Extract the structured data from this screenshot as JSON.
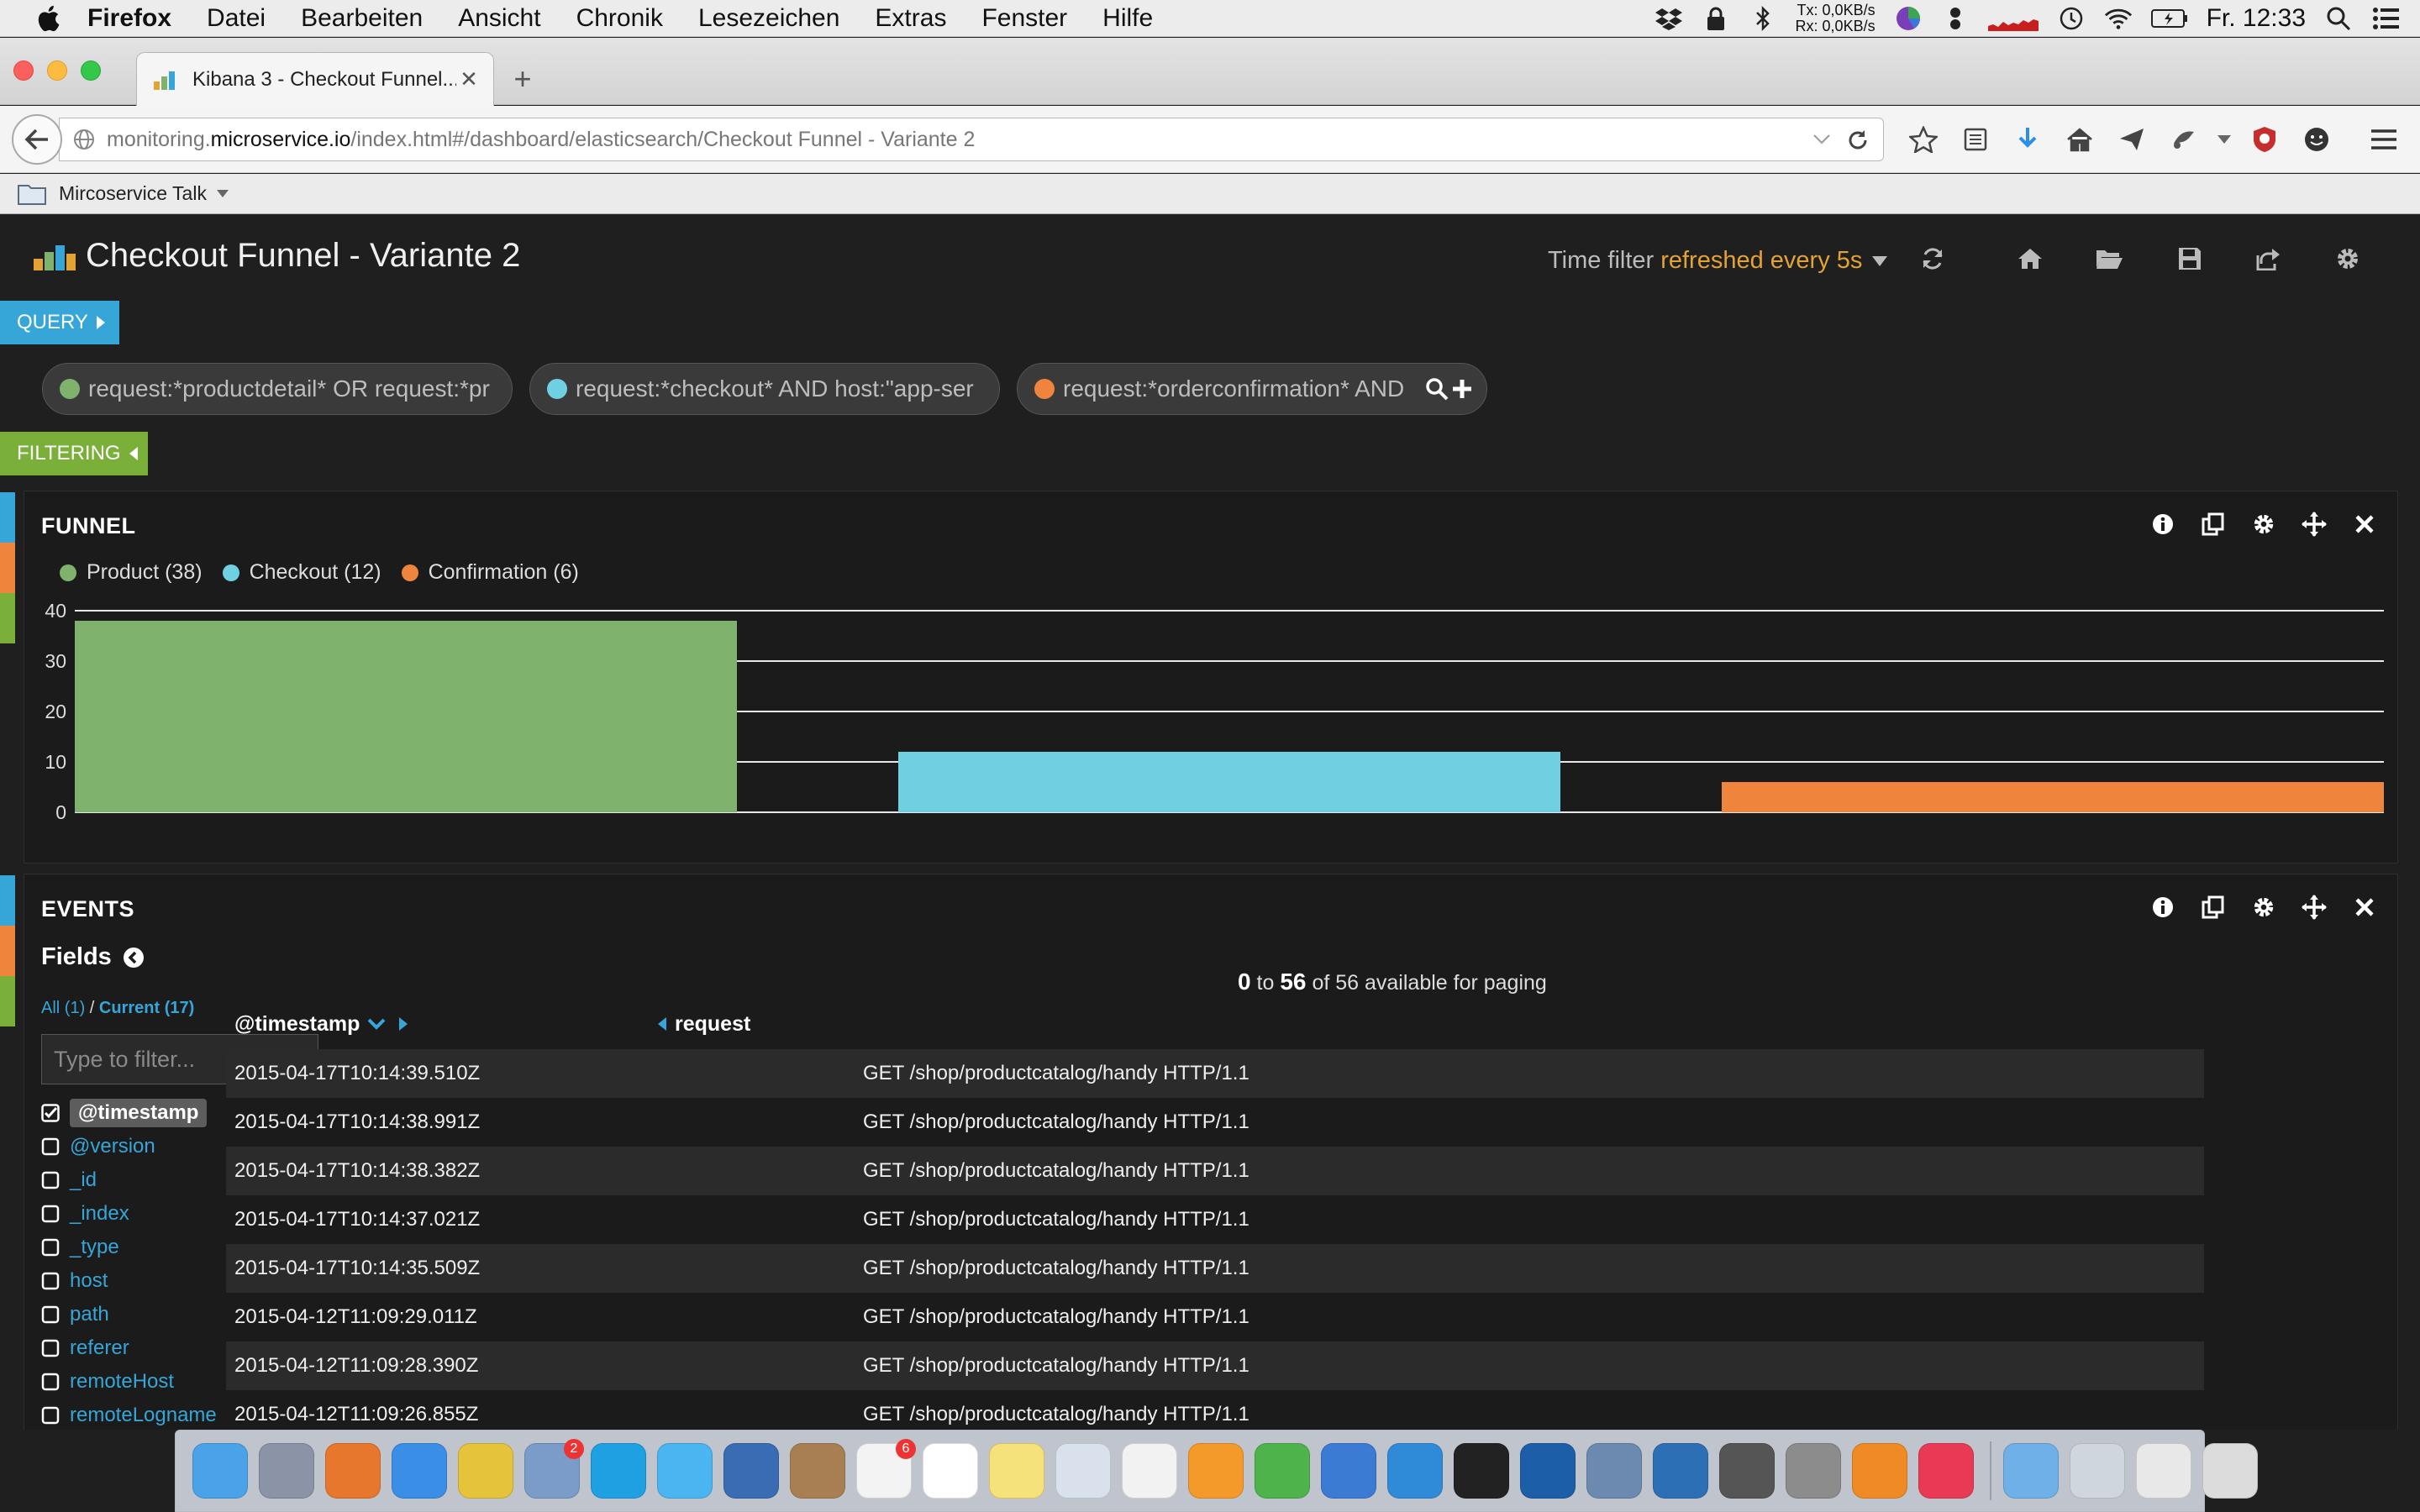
{
  "menubar": {
    "app_name": "Firefox",
    "items": [
      "Datei",
      "Bearbeiten",
      "Ansicht",
      "Chronik",
      "Lesezeichen",
      "Extras",
      "Fenster",
      "Hilfe"
    ],
    "net_tx_label": "Tx:",
    "net_tx_value": "0,0KB/s",
    "net_rx_label": "Rx:",
    "net_rx_value": "0,0KB/s",
    "clock": "Fr. 12:33"
  },
  "browser": {
    "tab_title": "Kibana 3 - Checkout Funnel...",
    "url_prefix": "monitoring.",
    "url_domain": "microservice.io",
    "url_path": "/index.html#/dashboard/elasticsearch/Checkout Funnel - Variante 2",
    "bookmark_folder": "Mircoservice Talk"
  },
  "dashboard": {
    "title": "Checkout Funnel - Variante 2",
    "time_filter_label": "Time filter",
    "time_filter_refresh": "refreshed every 5s",
    "query_label": "QUERY",
    "filtering_label": "FILTERING",
    "queries": [
      {
        "text": "request:*productdetail* OR request:*pr",
        "color": "#7eb26d"
      },
      {
        "text": "request:*checkout* AND host:\"app-ser",
        "color": "#6ed0e0"
      },
      {
        "text": "request:*orderconfirmation*  AND",
        "color": "#ef843c"
      }
    ],
    "row_colors": [
      "#36a6d8",
      "#ef843c",
      "#7aaf3a"
    ]
  },
  "funnel_panel": {
    "title": "FUNNEL",
    "legend": [
      "Product (38)",
      "Checkout (12)",
      "Confirmation (6)"
    ]
  },
  "chart_data": {
    "type": "bar",
    "title": "FUNNEL",
    "categories": [
      "Product",
      "Checkout",
      "Confirmation"
    ],
    "values": [
      38,
      12,
      6
    ],
    "colors": [
      "#7eb26d",
      "#6ed0e0",
      "#ef843c"
    ],
    "ylim": [
      0,
      40
    ],
    "yticks": [
      0,
      10,
      20,
      30,
      40
    ],
    "grid": true,
    "legend_placement": "top-left"
  },
  "events_panel": {
    "title": "EVENTS",
    "fields_title": "Fields",
    "fields_all": "All (1)",
    "fields_separator": "/",
    "fields_current": "Current (17)",
    "filter_placeholder": "Type to filter...",
    "fields": [
      {
        "name": "@timestamp",
        "checked": true
      },
      {
        "name": "@version",
        "checked": false
      },
      {
        "name": "_id",
        "checked": false
      },
      {
        "name": "_index",
        "checked": false
      },
      {
        "name": "_type",
        "checked": false
      },
      {
        "name": "host",
        "checked": false
      },
      {
        "name": "path",
        "checked": false
      },
      {
        "name": "referer",
        "checked": false
      },
      {
        "name": "remoteHost",
        "checked": false
      },
      {
        "name": "remoteLogname",
        "checked": false
      }
    ],
    "paging_from": "0",
    "paging_to_word": "to",
    "paging_to": "56",
    "paging_suffix": "of 56 available for paging",
    "columns": [
      "@timestamp",
      "request"
    ],
    "rows": [
      {
        "timestamp": "2015-04-17T10:14:39.510Z",
        "request": "GET /shop/productcatalog/handy HTTP/1.1"
      },
      {
        "timestamp": "2015-04-17T10:14:38.991Z",
        "request": "GET /shop/productcatalog/handy HTTP/1.1"
      },
      {
        "timestamp": "2015-04-17T10:14:38.382Z",
        "request": "GET /shop/productcatalog/handy HTTP/1.1"
      },
      {
        "timestamp": "2015-04-17T10:14:37.021Z",
        "request": "GET /shop/productcatalog/handy HTTP/1.1"
      },
      {
        "timestamp": "2015-04-17T10:14:35.509Z",
        "request": "GET /shop/productcatalog/handy HTTP/1.1"
      },
      {
        "timestamp": "2015-04-12T11:09:29.011Z",
        "request": "GET /shop/productcatalog/handy HTTP/1.1"
      },
      {
        "timestamp": "2015-04-12T11:09:28.390Z",
        "request": "GET /shop/productcatalog/handy HTTP/1.1"
      },
      {
        "timestamp": "2015-04-12T11:09:26.855Z",
        "request": "GET /shop/productcatalog/handy HTTP/1.1"
      }
    ]
  },
  "dock": {
    "apps": [
      {
        "name": "finder",
        "color": "#4aa3e8"
      },
      {
        "name": "launchpad",
        "color": "#8a94a6"
      },
      {
        "name": "firefox",
        "color": "#e8772e"
      },
      {
        "name": "safari",
        "color": "#3a8ee6"
      },
      {
        "name": "chrome",
        "color": "#e5c33a"
      },
      {
        "name": "mail",
        "color": "#7b9cc8",
        "badge": "2"
      },
      {
        "name": "skype",
        "color": "#1fa0e3"
      },
      {
        "name": "messages",
        "color": "#4ab5f0"
      },
      {
        "name": "quicktime",
        "color": "#3a6cb3"
      },
      {
        "name": "contacts",
        "color": "#a77f52"
      },
      {
        "name": "reminders",
        "color": "#f3f3f3",
        "badge": "6"
      },
      {
        "name": "calendar",
        "color": "#ffffff"
      },
      {
        "name": "notes",
        "color": "#f6e27a"
      },
      {
        "name": "preview",
        "color": "#d9e2ec"
      },
      {
        "name": "photos",
        "color": "#f2f2f2"
      },
      {
        "name": "pages",
        "color": "#f39a2a"
      },
      {
        "name": "numbers",
        "color": "#4fb34b"
      },
      {
        "name": "keynote",
        "color": "#3b7bd4"
      },
      {
        "name": "intellij",
        "color": "#2f8bd8"
      },
      {
        "name": "terminal",
        "color": "#222222"
      },
      {
        "name": "sourcetree",
        "color": "#1d5ea8"
      },
      {
        "name": "postgres",
        "color": "#6c8ab0"
      },
      {
        "name": "elephant",
        "color": "#2d6fb5"
      },
      {
        "name": "sublime",
        "color": "#555555"
      },
      {
        "name": "system-preferences",
        "color": "#8c8c8c"
      },
      {
        "name": "ibooks",
        "color": "#f08a24"
      },
      {
        "name": "itunes",
        "color": "#e83a55"
      },
      {
        "name": "applications-folder",
        "color": "#6fb0e8"
      },
      {
        "name": "home-folder",
        "color": "#cfd6de"
      },
      {
        "name": "downloads-stack",
        "color": "#e8e8e8"
      },
      {
        "name": "trash",
        "color": "#dcdcdc"
      }
    ]
  }
}
